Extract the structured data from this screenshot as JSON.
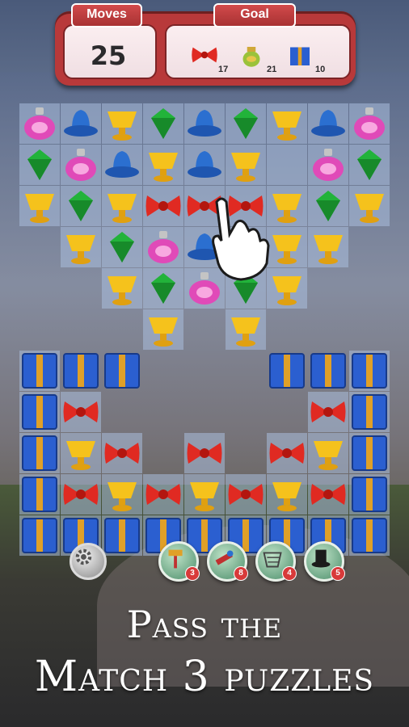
{
  "hud": {
    "moves_label": "Moves",
    "moves_value": "25",
    "goal_label": "Goal",
    "goals": [
      {
        "icon": "bow-icon",
        "count": "17"
      },
      {
        "icon": "vase-icon",
        "count": "21"
      },
      {
        "icon": "gift-box-icon",
        "count": "10"
      }
    ]
  },
  "boosters": [
    {
      "icon": "hammer-icon",
      "count": "3"
    },
    {
      "icon": "firework-icon",
      "count": "8"
    },
    {
      "icon": "net-icon",
      "count": "4"
    },
    {
      "icon": "hat-icon",
      "count": "5"
    }
  ],
  "caption": {
    "line1": "Pass the",
    "line2": "Match 3 puzzles"
  },
  "colors": {
    "frame": "#b8393a",
    "bow": "#e02a22",
    "gem": "#22b33a",
    "hat": "#2b6fd0",
    "perfume": "#e04ab8",
    "cup": "#f5c21c",
    "gift": "#2b5fd0"
  }
}
